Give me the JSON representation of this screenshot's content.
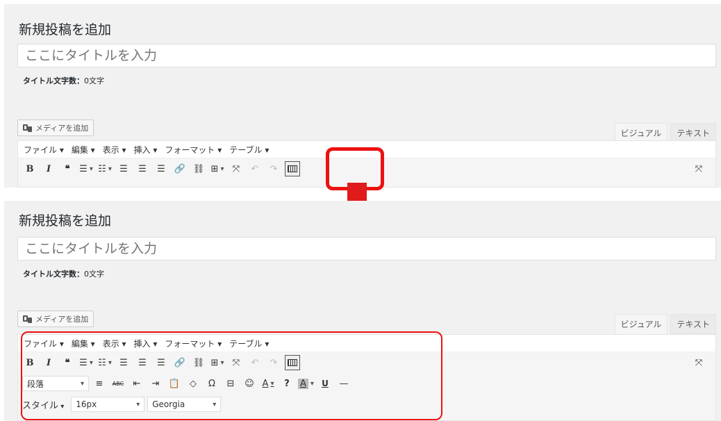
{
  "top": {
    "heading": "新規投稿を追加",
    "title_placeholder": "ここにタイトルを入力",
    "count_label": "タイトル文字数：",
    "count_value": "0文字",
    "media_button": "メディアを追加",
    "tabs": [
      "ビジュアル",
      "テキスト"
    ],
    "menus": [
      "ファイル ▾",
      "編集 ▾",
      "表示 ▾",
      "挿入 ▾",
      "フォーマット ▾",
      "テーブル ▾"
    ]
  },
  "bottom": {
    "heading": "新規投稿を追加",
    "title_placeholder": "ここにタイトルを入力",
    "count_label": "タイトル文字数：",
    "count_value": "0文字",
    "media_button": "メディアを追加",
    "tabs": [
      "ビジュアル",
      "テキスト"
    ],
    "menus": [
      "ファイル ▾",
      "編集 ▾",
      "表示 ▾",
      "挿入 ▾",
      "フォーマット ▾",
      "テーブル ▾"
    ],
    "paragraph_select": "段落",
    "style_menu": "スタイル",
    "font_size": "16px",
    "font_family": "Georgia"
  },
  "icons": {
    "bold": "B",
    "italic": "I",
    "quote": "❝",
    "ul": "☰",
    "ol": "☷",
    "align_left": "☰",
    "align_center": "☰",
    "align_right": "☰",
    "link": "🔗",
    "unlink": "⛓",
    "table": "⊞",
    "fullscreen": "⤧",
    "undo": "↶",
    "redo": "↷",
    "justify": "≡",
    "strike": "ABC",
    "outdent": "⇤",
    "indent": "⇥",
    "paste": "📋",
    "eraser": "◇",
    "omega": "Ω",
    "more": "⊟",
    "emoji": "☺",
    "text_color": "A",
    "help": "?",
    "bg_color": "A",
    "underline": "U",
    "hr": "—"
  },
  "colors": {
    "highlight": "#ee1111",
    "panel_bg": "#f1f1f1"
  }
}
